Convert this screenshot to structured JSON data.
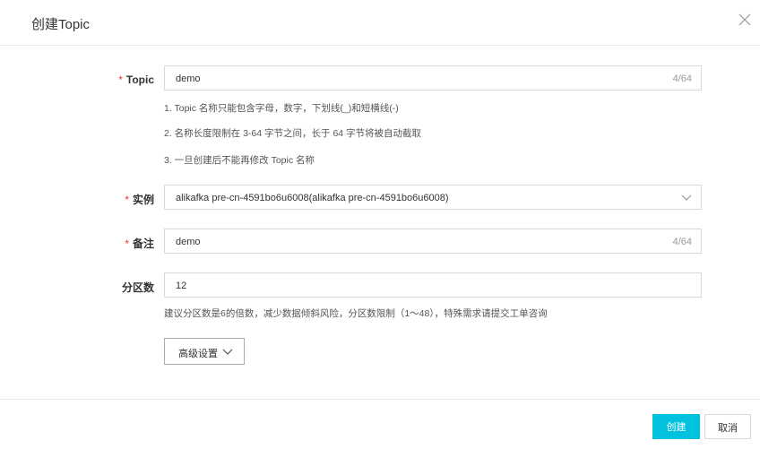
{
  "dialog": {
    "title": "创建Topic",
    "close_icon": "close-icon"
  },
  "form": {
    "topic": {
      "label": "Topic",
      "required_mark": "*",
      "value": "demo",
      "counter": "4/64"
    },
    "topic_hints": [
      "1. Topic 名称只能包含字母，数字，下划线(_)和短横线(-)",
      "2. 名称长度限制在 3-64 字节之间，长于 64 字节将被自动截取",
      "3. 一旦创建后不能再修改 Topic 名称"
    ],
    "instance": {
      "label": "实例",
      "required_mark": "*",
      "value": "alikafka  pre-cn-4591bo6u6008(alikafka  pre-cn-4591bo6u6008)",
      "icon": "chevron-down-icon"
    },
    "remark": {
      "label": "备注",
      "required_mark": "*",
      "value": "demo",
      "counter": "4/64"
    },
    "partitions": {
      "label": "分区数",
      "value": "12",
      "hint": "建议分区数是6的倍数，减少数据倾斜风险，分区数限制（1～48），特殊需求请提交工单咨询"
    },
    "advanced": {
      "label": "高级设置",
      "icon": "chevron-down-icon"
    }
  },
  "footer": {
    "create_label": "创建",
    "cancel_label": "取消",
    "primary_color": "#00c1de"
  }
}
